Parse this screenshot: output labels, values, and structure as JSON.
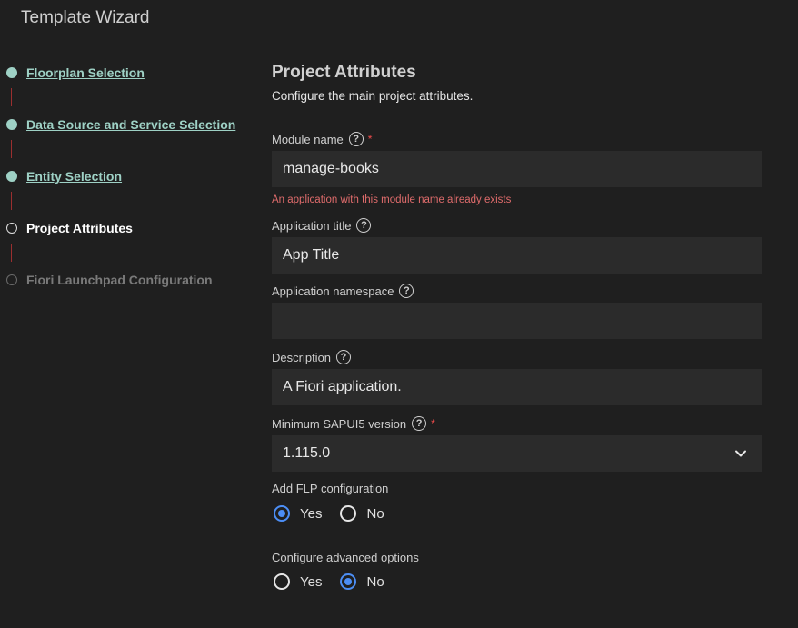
{
  "window": {
    "title": "Template Wizard"
  },
  "steps": [
    {
      "label": "Floorplan Selection",
      "state": "done"
    },
    {
      "label": "Data Source and Service Selection",
      "state": "done"
    },
    {
      "label": "Entity Selection",
      "state": "done"
    },
    {
      "label": "Project Attributes",
      "state": "current"
    },
    {
      "label": "Fiori Launchpad Configuration",
      "state": "future"
    }
  ],
  "page": {
    "title": "Project Attributes",
    "subtitle": "Configure the main project attributes."
  },
  "fields": {
    "module_name": {
      "label": "Module name",
      "value": "manage-books",
      "required_mark": "*",
      "error": "An application with this module name already exists"
    },
    "app_title": {
      "label": "Application title",
      "value": "App Title"
    },
    "app_namespace": {
      "label": "Application namespace",
      "value": ""
    },
    "description": {
      "label": "Description",
      "value": "A Fiori application."
    },
    "min_ui5": {
      "label": "Minimum SAPUI5 version",
      "value": "1.115.0",
      "required_mark": "*"
    },
    "add_flp": {
      "label": "Add FLP configuration",
      "options": [
        "Yes",
        "No"
      ],
      "selected": "Yes"
    },
    "advanced": {
      "label": "Configure advanced options",
      "options": [
        "Yes",
        "No"
      ],
      "selected": "No"
    }
  },
  "icons": {
    "help": "?",
    "chevron": "chevron-down-icon"
  },
  "colors": {
    "done": "#9ed1c5",
    "accent": "#4c8ef5",
    "error": "#e06c6c",
    "connector": "#9b2f2f"
  }
}
